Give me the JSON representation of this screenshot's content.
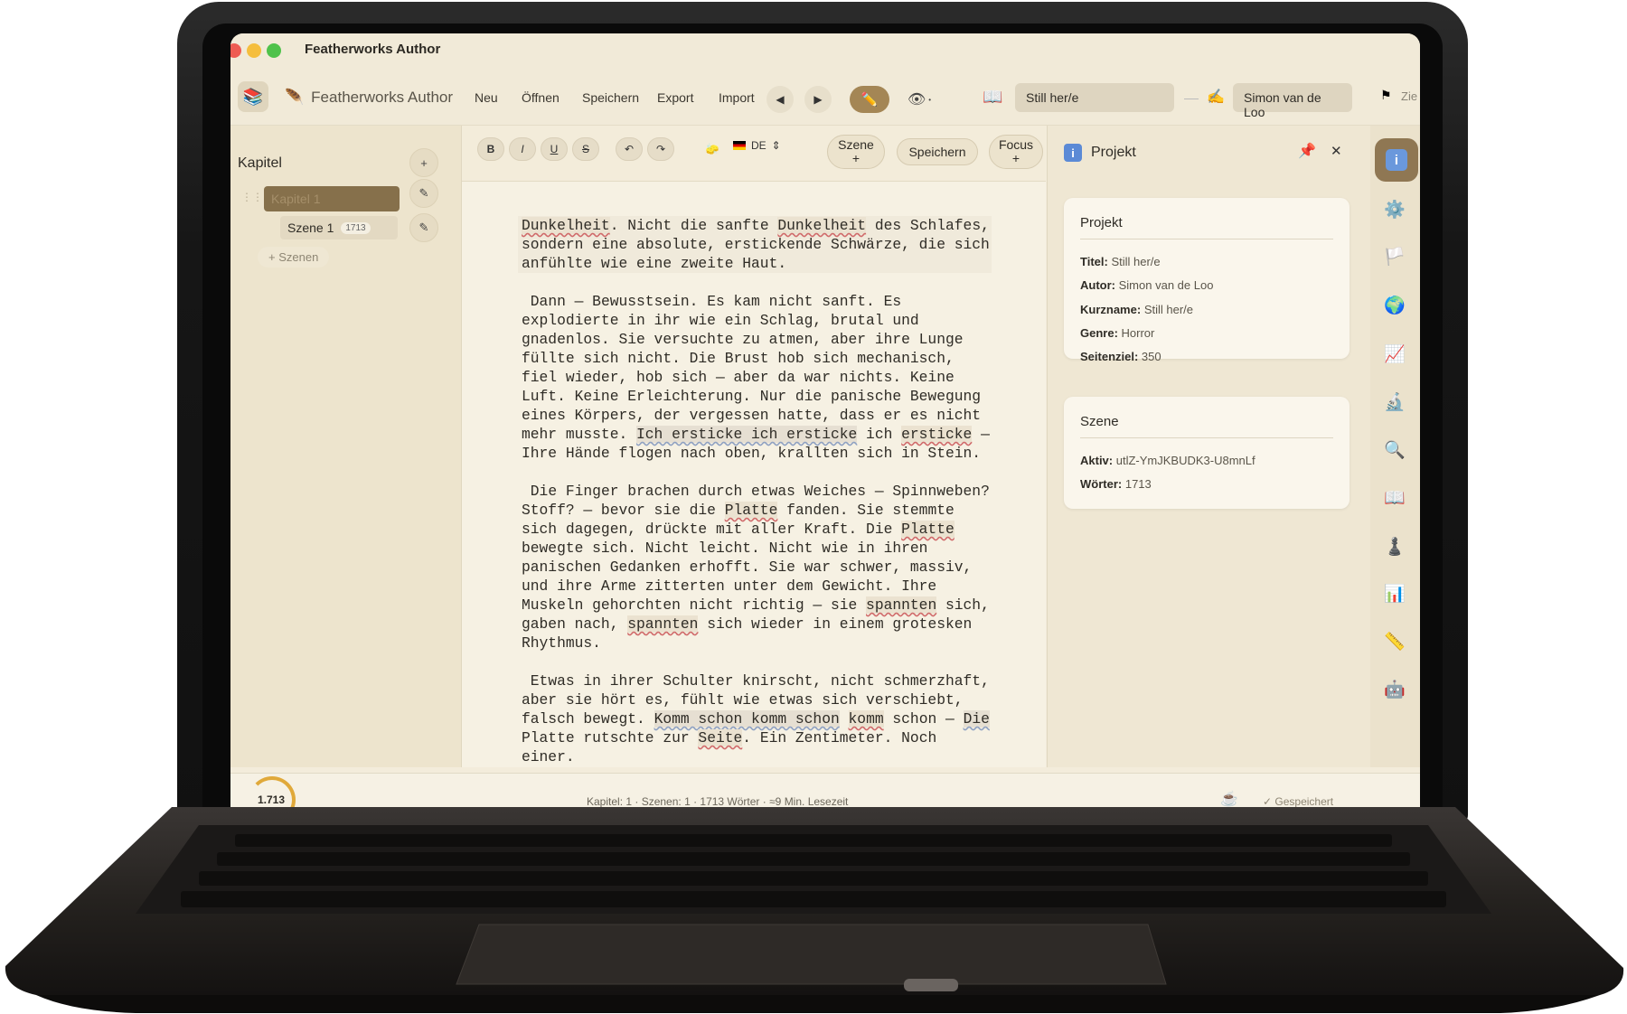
{
  "window": {
    "title": "Featherworks Author"
  },
  "toolbar": {
    "brand": "Featherworks Author",
    "menu": [
      "Neu",
      "Öffnen",
      "Speichern",
      "Export",
      "Import"
    ],
    "book_title": "Still her/e",
    "author": "Simon van de Loo",
    "goal_label": "Zie"
  },
  "sidebar": {
    "title": "Kapitel",
    "chapter": "Kapitel 1",
    "scene": "Szene 1",
    "scene_words": "1713",
    "add_scene": "+ Szenen"
  },
  "format_bar": {
    "bold": "B",
    "italic": "I",
    "underline": "U",
    "strike": "S",
    "language": "DE",
    "scene_button": "Szene +",
    "save_button": "Speichern",
    "focus_button": "Focus +"
  },
  "panel": {
    "title": "Projekt",
    "project_card": {
      "title": "Projekt",
      "fields": [
        {
          "label": "Titel:",
          "value": "Still her/e"
        },
        {
          "label": "Autor:",
          "value": "Simon van de Loo"
        },
        {
          "label": "Kurzname:",
          "value": "Still her/e"
        },
        {
          "label": "Genre:",
          "value": "Horror"
        },
        {
          "label": "Seitenziel:",
          "value": "350"
        }
      ]
    },
    "scene_card": {
      "title": "Szene",
      "fields": [
        {
          "label": "Aktiv:",
          "value": "utlZ-YmJKBUDK3-U8mnLf"
        },
        {
          "label": "Wörter:",
          "value": "1713"
        }
      ]
    }
  },
  "status": {
    "word_total": "1.713",
    "summary": "Kapitel: 1 · Szenen: 1 · 1713 Wörter · ≈9 Min. Lesezeit",
    "saved": "✓ Gespeichert"
  },
  "rail_icons": [
    "info-icon",
    "gear-icon",
    "flag-icon",
    "globe-icon",
    "trend-chart-icon",
    "microscope-icon",
    "magnifier-icon",
    "book-icon",
    "figure-icon",
    "bar-chart-icon",
    "ruler-icon",
    "robot-icon"
  ],
  "colors": {
    "accent": "#a48655",
    "background": "#f3ecdb",
    "active_chapter": "#86704b"
  }
}
